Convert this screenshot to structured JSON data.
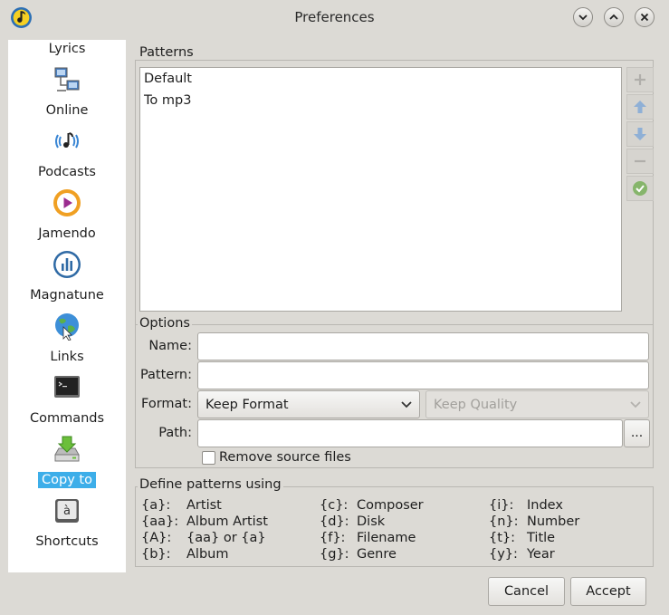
{
  "window": {
    "title": "Preferences"
  },
  "sidebar": {
    "items": [
      {
        "label": "Lyrics"
      },
      {
        "label": "Online"
      },
      {
        "label": "Podcasts"
      },
      {
        "label": "Jamendo"
      },
      {
        "label": "Magnatune"
      },
      {
        "label": "Links"
      },
      {
        "label": "Commands"
      },
      {
        "label": "Copy to"
      },
      {
        "label": "Shortcuts"
      }
    ],
    "selected": "Copy to"
  },
  "patterns": {
    "group_label": "Patterns",
    "items": [
      "Default",
      "To mp3"
    ]
  },
  "options": {
    "group_label": "Options",
    "name_label": "Name:",
    "name_value": "",
    "pattern_label": "Pattern:",
    "pattern_value": "",
    "format_label": "Format:",
    "format_value": "Keep Format",
    "quality_value": "Keep Quality",
    "path_label": "Path:",
    "path_value": "",
    "browse_label": "...",
    "remove_source_label": "Remove source files",
    "remove_source_checked": false
  },
  "define": {
    "group_label": "Define patterns using",
    "columns": [
      [
        {
          "code": "{a}:",
          "desc": "Artist"
        },
        {
          "code": "{aa}:",
          "desc": "Album Artist"
        },
        {
          "code": "{A}:",
          "desc": "{aa} or {a}"
        },
        {
          "code": "{b}:",
          "desc": "Album"
        }
      ],
      [
        {
          "code": "{c}:",
          "desc": "Composer"
        },
        {
          "code": "{d}:",
          "desc": "Disk"
        },
        {
          "code": "{f}:",
          "desc": "Filename"
        },
        {
          "code": "{g}:",
          "desc": "Genre"
        }
      ],
      [
        {
          "code": "{i}:",
          "desc": "Index"
        },
        {
          "code": "{n}:",
          "desc": "Number"
        },
        {
          "code": "{t}:",
          "desc": "Title"
        },
        {
          "code": "{y}:",
          "desc": "Year"
        }
      ]
    ]
  },
  "buttons": {
    "cancel": "Cancel",
    "accept": "Accept"
  },
  "colors": {
    "selection": "#3daee9",
    "background": "#dcdad5"
  }
}
